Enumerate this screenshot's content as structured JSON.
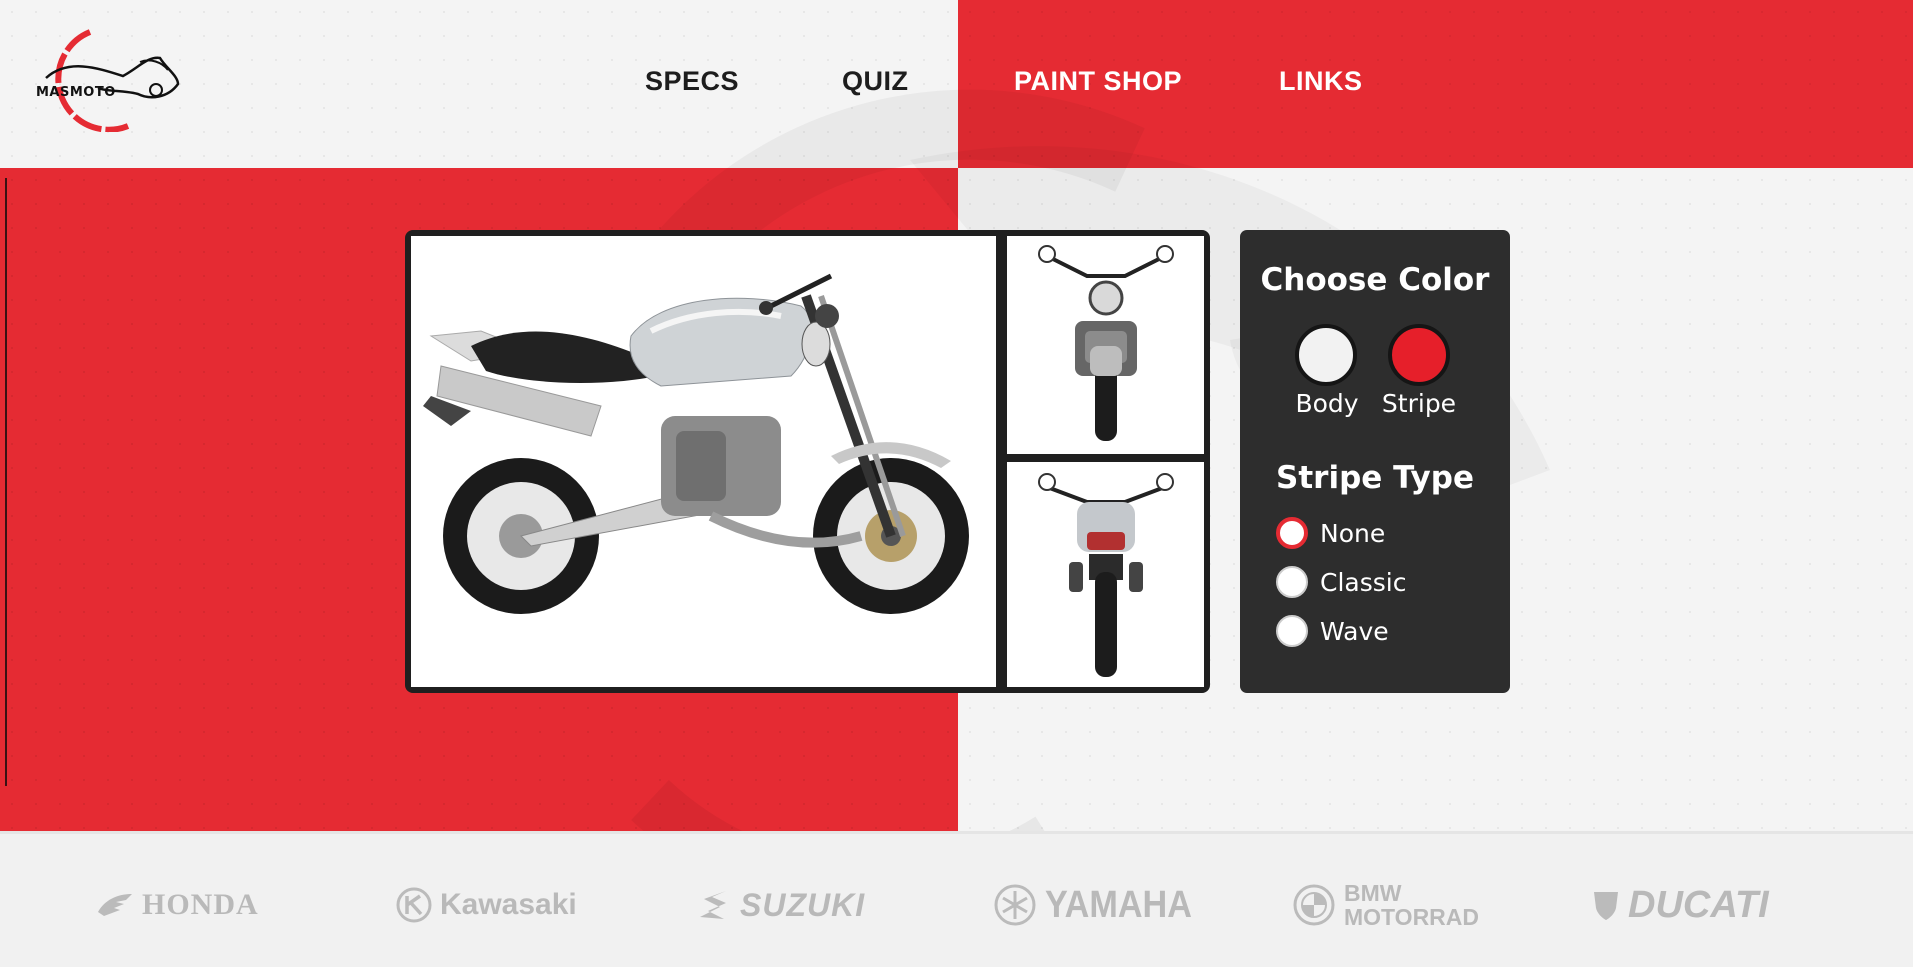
{
  "header": {
    "logo_text": "MASMOTO",
    "nav": [
      {
        "label": "SPECS"
      },
      {
        "label": "QUIZ"
      },
      {
        "label": "PAINT SHOP"
      },
      {
        "label": "LINKS"
      }
    ]
  },
  "gallery": {
    "main_image": "motorcycle-side-view",
    "thumbnails": [
      "motorcycle-front-view",
      "motorcycle-rear-view"
    ]
  },
  "options": {
    "color_title": "Choose Color",
    "swatches": [
      {
        "label": "Body",
        "color": "#f2f2f2"
      },
      {
        "label": "Stripe",
        "color": "#e61f2a"
      }
    ],
    "stripe_title": "Stripe Type",
    "stripe_types": [
      {
        "label": "None",
        "selected": true
      },
      {
        "label": "Classic",
        "selected": false
      },
      {
        "label": "Wave",
        "selected": false
      }
    ]
  },
  "brands": [
    {
      "name": "HONDA",
      "icon": "honda-wing-icon"
    },
    {
      "name": "Kawasaki",
      "icon": "kawasaki-k-icon"
    },
    {
      "name": "SUZUKI",
      "icon": "suzuki-s-icon"
    },
    {
      "name": "YAMAHA",
      "icon": "yamaha-tuning-fork-icon"
    },
    {
      "name": "BMW",
      "name2": "MOTORRAD",
      "icon": "bmw-roundel-icon"
    },
    {
      "name": "DUCATI",
      "icon": "ducati-shield-icon"
    }
  ],
  "colors": {
    "accent": "#e52b33",
    "dark_panel": "#2d2d2d",
    "page_bg": "#f4f4f4"
  }
}
